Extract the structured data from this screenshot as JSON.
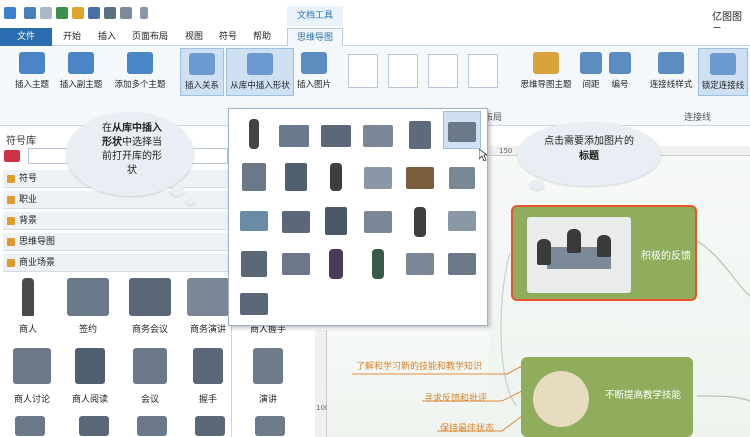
{
  "window": {
    "context_tab": "文档工具",
    "app_title": "亿图图示"
  },
  "tabs": [
    "文件",
    "开始",
    "插入",
    "页面布局",
    "视图",
    "符号",
    "帮助",
    "思维导图"
  ],
  "ribbon": {
    "insert_topic": "插入主题",
    "insert_subtopic": "插入副主题",
    "add_multiple": "添加多个主题",
    "insert_relation": "插入关系",
    "insert_from_library": "从库中插入形状",
    "insert_image": "插入图片",
    "mindmap_theme": "思维导图主题",
    "spacing": "间距",
    "numbering": "编号",
    "connector_style": "连接线样式",
    "lock_connector": "锁定连接线",
    "group_layout": "布局",
    "group_connector": "连接线"
  },
  "sidebar": {
    "title": "符号库",
    "categories": [
      "符号",
      "职业",
      "背景",
      "思维导图",
      "商业场景"
    ],
    "shapes": [
      "商人",
      "签约",
      "商务会议",
      "商务演讲",
      "商人握手",
      "商人讨论",
      "商人阅读",
      "会议",
      "握手",
      "演讲"
    ]
  },
  "ruler": {
    "top_mark": "150",
    "left_mark": "100"
  },
  "callout_left": {
    "line1_a": "在",
    "line1_b": "从库中插入",
    "line2_a": "形状",
    "line2_b": "中选择当",
    "line3": "前打开库的形",
    "line4": "状"
  },
  "callout_right": {
    "line1": "点击需要添加图片的",
    "line2": "标题"
  },
  "mindmap": {
    "topic1": "积极的反馈",
    "topic2": "不断提高教学技能",
    "sub1": "了解和学习新的技能和教学知识",
    "sub2": "寻求反馈和批评",
    "sub3": "保持最佳状态"
  },
  "colors": {
    "accent": "#2b6cb0",
    "topic_green": "#8fad5c",
    "topic_border": "#e8542b",
    "sub_orange": "#d9822b"
  }
}
